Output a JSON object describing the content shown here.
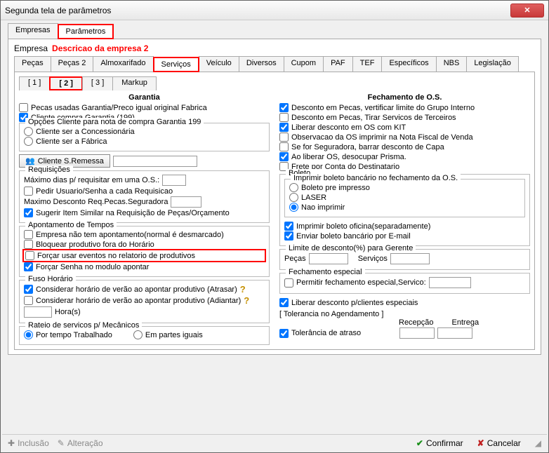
{
  "window": {
    "title": "Segunda tela de parâmetros"
  },
  "topTabs": {
    "empresas": "Empresas",
    "parametros": "Parâmetros"
  },
  "header": {
    "label": "Empresa",
    "desc": "Descricao da empresa 2"
  },
  "subTabs": {
    "pecas": "Peças",
    "pecas2": "Peças 2",
    "almox": "Almoxarifado",
    "servicos": "Serviços",
    "veiculo": "Veículo",
    "diversos": "Diversos",
    "cupom": "Cupom",
    "paf": "PAF",
    "tef": "TEF",
    "especificos": "Específicos",
    "nbs": "NBS",
    "legislacao": "Legislação"
  },
  "pageTabs": {
    "t1": "[ 1 ]",
    "t2": "[  2  ]",
    "t3": "[ 3 ]",
    "markup": "Markup"
  },
  "left": {
    "title": "Garantia",
    "c1": "Pecas usadas Garantia/Preco igual original Fabrica",
    "c2": "Cliente compra Garantia (199)",
    "grpOpcoes": "Opções Cliente para nota de compra Garantia 199",
    "r1": "Cliente ser a Concessionária",
    "r2": "Cliente ser a Fábrica",
    "btnRemessa": "Cliente S.Remessa",
    "grpReq": "Requisições",
    "lblMaxDias": "Máximo dias p/ requisitar em uma O.S.:",
    "c3": "Pedir Usuario/Senha a cada Requisicao",
    "lblMaxDesc": "Maximo Desconto Req.Pecas.Seguradora",
    "c4": "Sugerir Item Similar na Requisição de Peças/Orçamento",
    "grpApont": "Apontamento de Tempos",
    "c5": "Empresa não tem apontamento(normal é desmarcado)",
    "c6": "Bloquear produtivo fora do Horário",
    "c7": "Forçar usar eventos no relatorio de produtivos",
    "c8": "Forçar Senha no modulo apontar",
    "grpFuso": "Fuso Horário",
    "c9": "Considerar horário de verão ao apontar produtivo (Atrasar)",
    "c10": "Considerar horário de verão ao apontar produtivo (Adiantar)",
    "lblHoras": "Hora(s)",
    "grpRateio": "Rateio de servicos p/ Mecânicos",
    "r3": "Por tempo Trabalhado",
    "r4": "Em partes iguais"
  },
  "right": {
    "title": "Fechamento de O.S.",
    "c1": "Desconto em Pecas, vertificar limite do Grupo Interno",
    "c2": "Desconto em Pecas, Tirar Servicos de Terceiros",
    "c3": "Liberar desconto em OS com KIT",
    "c4": "Observacao da OS imprimir na Nota Fiscal de Venda",
    "c5": "Se for Seguradora, barrar desconto de Capa",
    "c6": "Ao liberar OS, desocupar Prisma.",
    "c7": "Frete por Conta do Destinatario",
    "grpBoleto": "Boleto",
    "grpBoletoInner": "Imprimir boleto bancário no fechamento da O.S.",
    "r1": "Boleto pre impresso",
    "r2": "LASER",
    "r3": "Nao imprimir",
    "c8": "Imprimir boleto oficina(separadamente)",
    "c9": "Enviar boleto bancário por E-mail",
    "grpLimite": "Limite de desconto(%) para Gerente",
    "lblPecas": "Peças",
    "lblServ": "Serviços",
    "grpFechEsp": "Fechamento especial",
    "c10": "Permitir fechamento especial,Servico:",
    "c11": "Liberar desconto p/clientes especiais",
    "lblTol": "[ Tolerancia no Agendamento ]",
    "lblRecep": "Recepção",
    "lblEntrega": "Entrega",
    "c12": "Tolerância de atraso"
  },
  "footer": {
    "inclusao": "Inclusão",
    "alteracao": "Alteração",
    "confirmar": "Confirmar",
    "cancelar": "Cancelar"
  }
}
